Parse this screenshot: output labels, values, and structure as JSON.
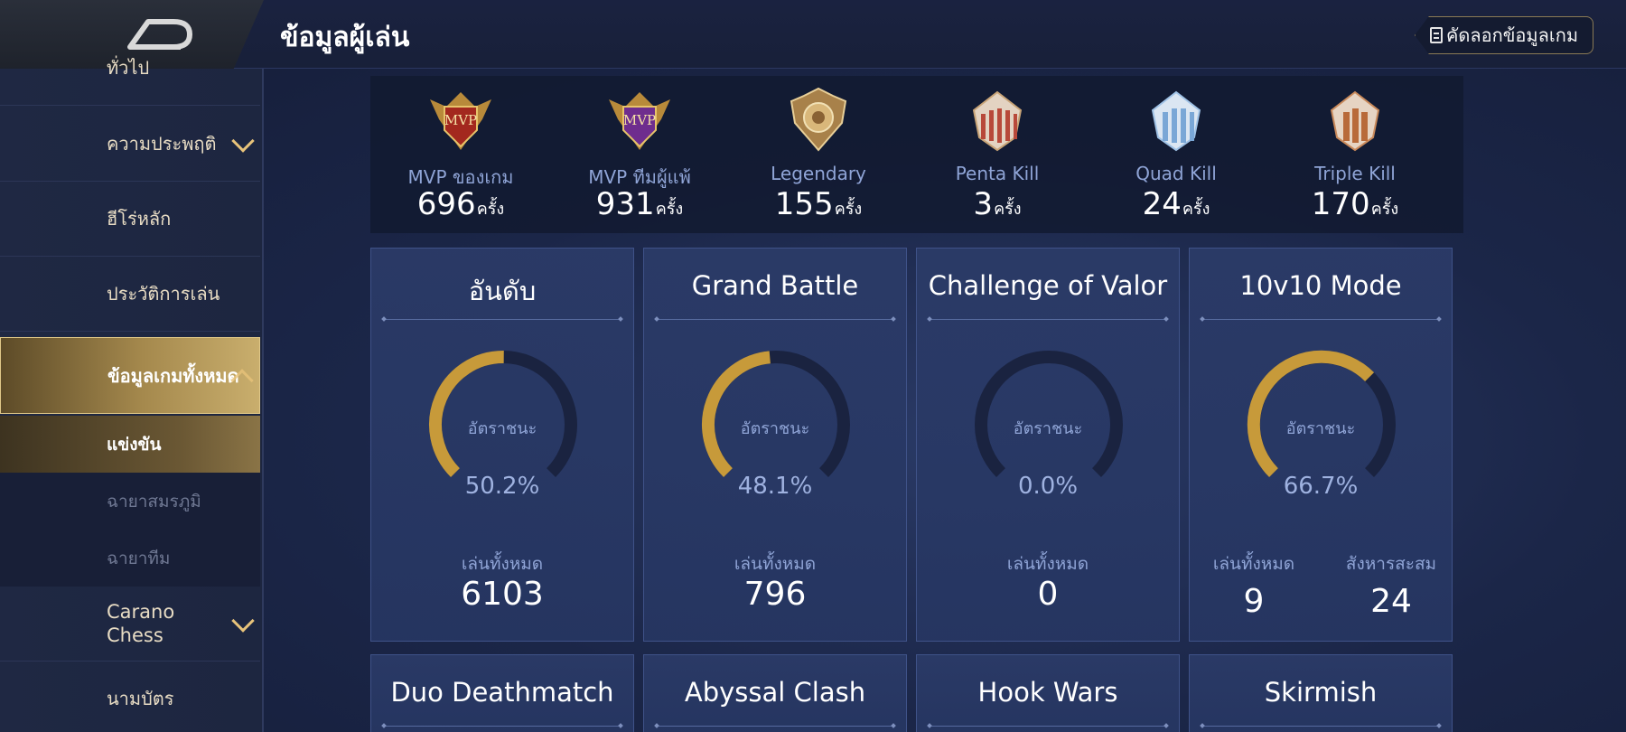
{
  "header": {
    "title": "ข้อมูลผู้เล่น",
    "copy_button": "คัดลอกข้อมูลเกม"
  },
  "sidebar": {
    "items": [
      {
        "label": "ทั่วไป"
      },
      {
        "label": "ความประพฤติ"
      },
      {
        "label": "ฮีโร่หลัก"
      },
      {
        "label": "ประวัติการเล่น"
      },
      {
        "label": "ข้อมูลเกมทั้งหมด"
      },
      {
        "label": "Carano Chess"
      },
      {
        "label": "นามบัตร"
      }
    ],
    "subitems": [
      {
        "label": "แข่งขัน"
      },
      {
        "label": "ฉายาสมรภูมิ"
      },
      {
        "label": "ฉายาทีม"
      }
    ]
  },
  "achievements": [
    {
      "name": "MVP ของเกม",
      "count": "696",
      "unit": "ครั้ง",
      "icon": "mvp-red-badge-icon",
      "color": "#c0392b"
    },
    {
      "name": "MVP ทีมผู้แพ้",
      "count": "931",
      "unit": "ครั้ง",
      "icon": "mvp-purple-badge-icon",
      "color": "#8e44ad"
    },
    {
      "name": "Legendary",
      "count": "155",
      "unit": "ครั้ง",
      "icon": "legendary-badge-icon",
      "color": "#c9a063"
    },
    {
      "name": "Penta Kill",
      "count": "3",
      "unit": "ครั้ง",
      "icon": "penta-kill-badge-icon",
      "color": "#d98a5a"
    },
    {
      "name": "Quad Kill",
      "count": "24",
      "unit": "ครั้ง",
      "icon": "quad-kill-badge-icon",
      "color": "#8fb8e0"
    },
    {
      "name": "Triple Kill",
      "count": "170",
      "unit": "ครั้ง",
      "icon": "triple-kill-badge-icon",
      "color": "#c9895a"
    }
  ],
  "modes": [
    {
      "title": "อันดับ",
      "rate_label": "อัตราชนะ",
      "rate": "50.2%",
      "rate_value": 0.502,
      "total_label": "เล่นทั้งหมด",
      "total": "6103"
    },
    {
      "title": "Grand Battle",
      "rate_label": "อัตราชนะ",
      "rate": "48.1%",
      "rate_value": 0.481,
      "total_label": "เล่นทั้งหมด",
      "total": "796"
    },
    {
      "title": "Challenge of Valor",
      "rate_label": "อัตราชนะ",
      "rate": "0.0%",
      "rate_value": 0.0,
      "total_label": "เล่นทั้งหมด",
      "total": "0"
    },
    {
      "title": "10v10 Mode",
      "rate_label": "อัตราชนะ",
      "rate": "66.7%",
      "rate_value": 0.667,
      "total_label": "เล่นทั้งหมด",
      "total": "9",
      "extra_label": "สังหารสะสม",
      "extra": "24"
    }
  ],
  "modes_row2": [
    {
      "title": "Duo Deathmatch"
    },
    {
      "title": "Abyssal Clash"
    },
    {
      "title": "Hook Wars"
    },
    {
      "title": "Skirmish"
    }
  ],
  "colors": {
    "gauge_fill": "#c79a3a",
    "gauge_track": "#1a2340",
    "accent_gold": "#e0c888"
  }
}
